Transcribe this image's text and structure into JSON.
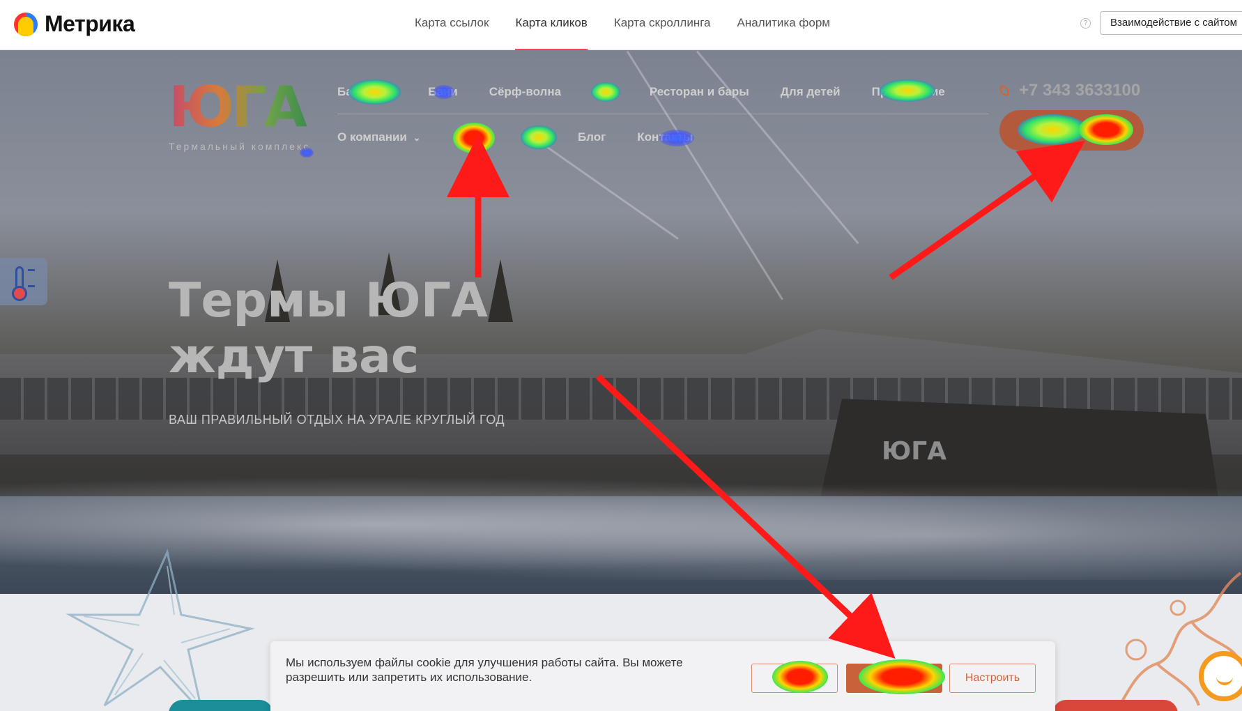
{
  "metrika": {
    "logo_text": "Метрика",
    "tabs": [
      {
        "label": "Карта ссылок",
        "active": false
      },
      {
        "label": "Карта кликов",
        "active": true
      },
      {
        "label": "Карта скроллинга",
        "active": false
      },
      {
        "label": "Аналитика форм",
        "active": false
      }
    ],
    "help_icon": "?",
    "interaction_button": "Взаимодействие с сайтом"
  },
  "site": {
    "logo_word": "ЮГА",
    "logo_subtitle": "Термальный комплекс",
    "nav_primary": [
      "Бассейны",
      "Бани",
      "Сёрф-волна",
      "СПА",
      "Ресторан и бары",
      "Для детей",
      "Проживание"
    ],
    "nav_secondary": [
      "О компании",
      "",
      "и",
      "Блог",
      "Контакты"
    ],
    "nav_dropdown_icon": "chevron-down-icon",
    "phone": "+7 343 3633100",
    "buy_button": "Купить",
    "hero_title_line1": "Термы ЮГА",
    "hero_title_line2": "ждут вас",
    "hero_subtitle": "ВАШ ПРАВИЛЬНЫЙ ОТДЫХ НА УРАЛЕ КРУГЛЫЙ ГОД",
    "building_sign": "ЮГА"
  },
  "cookie_banner": {
    "text": "Мы используем файлы cookie для улучшения работы сайта. Вы можете разрешить или запретить их использование.",
    "reject_label": "О",
    "accept_label": "",
    "settings_label": "Настроить"
  },
  "colors": {
    "accent_tab": "#ff4444",
    "arrow": "#ff1a1a",
    "buy_button": "#b45a3c",
    "cookie_accent": "#c9623a",
    "chat_widget": "#f39a1f"
  }
}
